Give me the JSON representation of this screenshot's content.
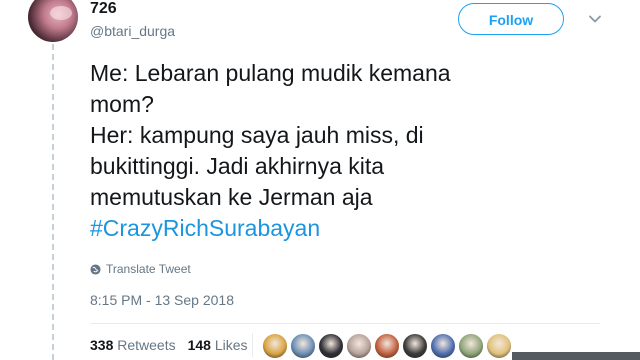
{
  "user": {
    "display_name": "726",
    "handle": "@btari_durga"
  },
  "follow_button": {
    "label": "Follow"
  },
  "tweet": {
    "lines": [
      "Me: Lebaran pulang mudik kemana",
      "mom?",
      "Her: kampung saya jauh miss, di",
      "bukittinggi. Jadi akhirnya kita",
      "memutuskan ke Jerman aja"
    ],
    "hashtag": "#CrazyRichSurabayan"
  },
  "translate_label": "Translate Tweet",
  "timestamp": "8:15 PM - 13 Sep 2018",
  "stats": {
    "retweets_count": "338",
    "retweets_label": "Retweets",
    "likes_count": "148",
    "likes_label": "Likes"
  },
  "colors": {
    "accent": "#1da1f2",
    "hashtag": "#1b95e0",
    "muted": "#657786",
    "text": "#14171a"
  },
  "icons": {
    "translate": "globe-icon",
    "menu": "chevron-down-icon"
  },
  "liker_avatar_colors": [
    "#d9a441",
    "#6b8fb5",
    "#2f2f35",
    "#b7a39a",
    "#c2613f",
    "#3a3a3a",
    "#4f6fb0",
    "#8ea67a",
    "#e1c27a"
  ]
}
